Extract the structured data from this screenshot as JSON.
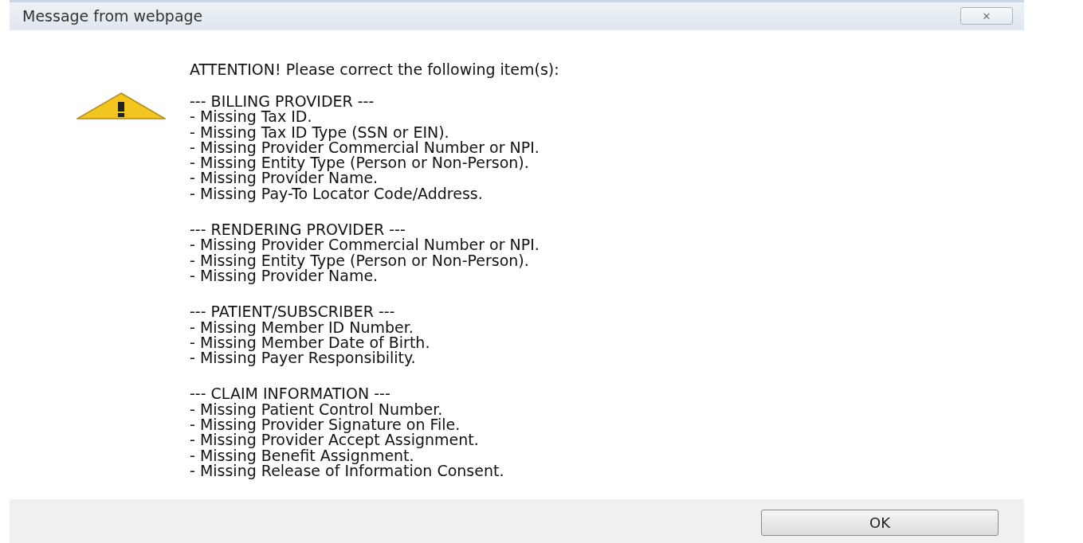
{
  "window": {
    "title": "Message from webpage",
    "close_symbol": "✕"
  },
  "message": {
    "heading": "ATTENTION!  Please correct the following item(s):",
    "sections": [
      {
        "header": "--- BILLING PROVIDER ---",
        "items": [
          "- Missing Tax ID.",
          "- Missing Tax ID Type (SSN or EIN).",
          "- Missing Provider Commercial Number or NPI.",
          "- Missing Entity Type (Person or Non-Person).",
          "- Missing Provider Name.",
          "- Missing Pay-To Locator Code/Address."
        ]
      },
      {
        "header": "--- RENDERING PROVIDER ---",
        "items": [
          "- Missing Provider Commercial Number or NPI.",
          "- Missing Entity Type (Person or Non-Person).",
          "- Missing Provider Name."
        ]
      },
      {
        "header": "--- PATIENT/SUBSCRIBER ---",
        "items": [
          "- Missing Member ID Number.",
          "- Missing Member Date of Birth.",
          "- Missing Payer Responsibility."
        ]
      },
      {
        "header": "--- CLAIM INFORMATION ---",
        "items": [
          "- Missing Patient Control Number.",
          "- Missing Provider Signature on File.",
          "- Missing Provider Accept Assignment.",
          "- Missing Benefit Assignment.",
          "- Missing Release of Information Consent."
        ]
      }
    ]
  },
  "buttons": [
    "OK"
  ]
}
